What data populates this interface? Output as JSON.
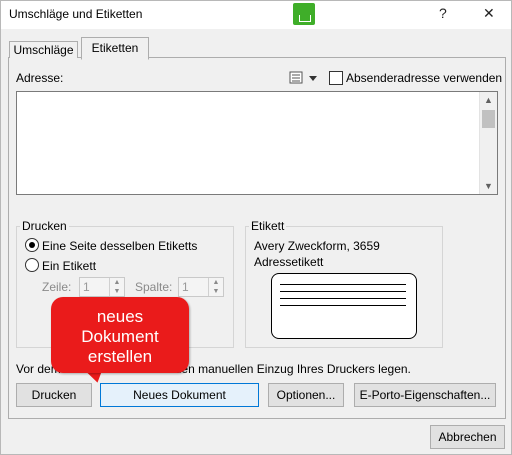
{
  "window": {
    "title": "Umschläge und Etiketten",
    "help": "?",
    "close": "✕"
  },
  "tabs": [
    {
      "label": "Umschläge"
    },
    {
      "label": "Etiketten"
    }
  ],
  "address": {
    "label": "Adresse:",
    "value": "",
    "use_sender_label": "Absenderadresse verwenden"
  },
  "print_group": {
    "title": "Drucken",
    "option_full_page": "Eine Seite desselben Etiketts",
    "option_single": "Ein Etikett",
    "row_label": "Zeile:",
    "row_value": "1",
    "col_label": "Spalte:",
    "col_value": "1"
  },
  "label_group": {
    "title": "Etikett",
    "product": "Avery Zweckform, 3659",
    "type": "Adressetikett"
  },
  "notice": "Vor dem Drucken Etiketten in den manuellen Einzug Ihres Druckers legen.",
  "buttons": {
    "print": "Drucken",
    "new_document": "Neues Dokument",
    "options": "Optionen...",
    "eporto": "E-Porto-Eigenschaften...",
    "cancel": "Abbrechen"
  },
  "callout": {
    "line1": "neues",
    "line2": "Dokument",
    "line3": "erstellen"
  },
  "colors": {
    "callout": "#ea1b1b",
    "focus": "#0078d7"
  }
}
